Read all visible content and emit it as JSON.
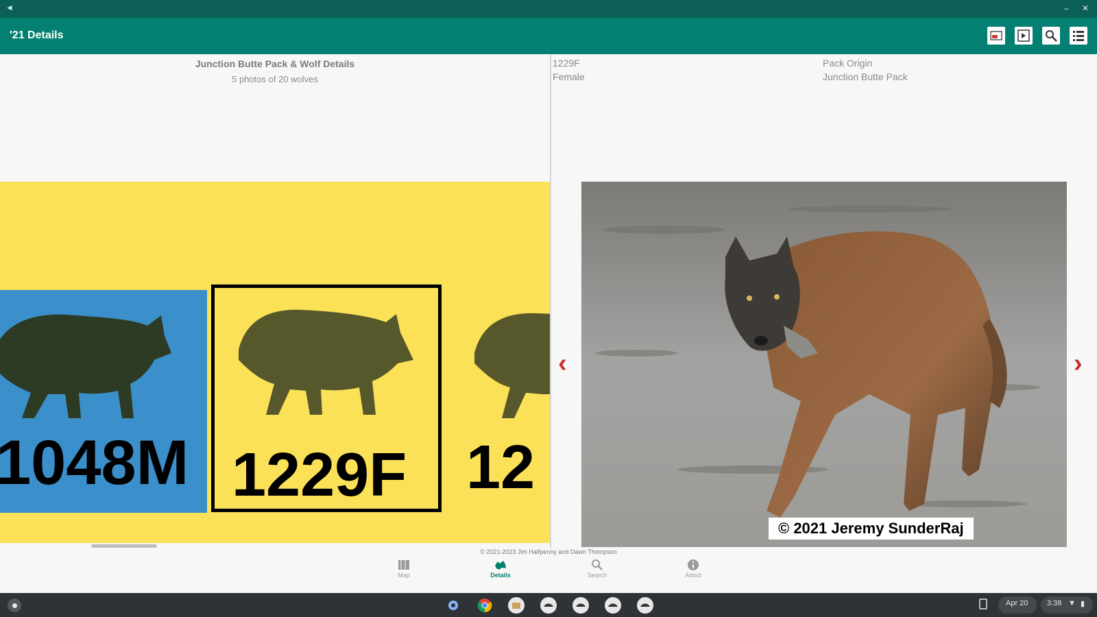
{
  "app": {
    "title": "'21 Details"
  },
  "left_header": {
    "title": "Junction Butte Pack & Wolf Details",
    "subtitle": "5 photos of 20 wolves"
  },
  "wolf_info": {
    "id": "1229F",
    "sex": "Female",
    "origin_label": "Pack Origin",
    "origin_value": "Junction Butte Pack"
  },
  "carousel": {
    "cards": [
      {
        "label": "1048M",
        "bg": "#3b8fca",
        "selected": false
      },
      {
        "label": "1229F",
        "bg": "#fae157",
        "selected": true
      },
      {
        "label": "12",
        "bg": "#fae157",
        "selected": false
      }
    ]
  },
  "photo": {
    "credit": "© 2021 Jeremy SunderRaj"
  },
  "footer": {
    "copyright": "© 2021-2023 Jim Halfpenny and Dawn Thompson"
  },
  "bottom_nav": [
    {
      "label": "Map",
      "icon": "map-icon",
      "active": false
    },
    {
      "label": "Details",
      "icon": "wolf-icon",
      "active": true
    },
    {
      "label": "Search",
      "icon": "search-icon",
      "active": false
    },
    {
      "label": "About",
      "icon": "info-icon",
      "active": false
    }
  ],
  "system": {
    "date": "Apr 20",
    "time": "3:38"
  },
  "colors": {
    "accent": "#038071",
    "titlebar": "#0b5f55",
    "carousel_bg": "#fae157",
    "card_blue": "#3b8fca",
    "arrow": "#c82b2b"
  }
}
